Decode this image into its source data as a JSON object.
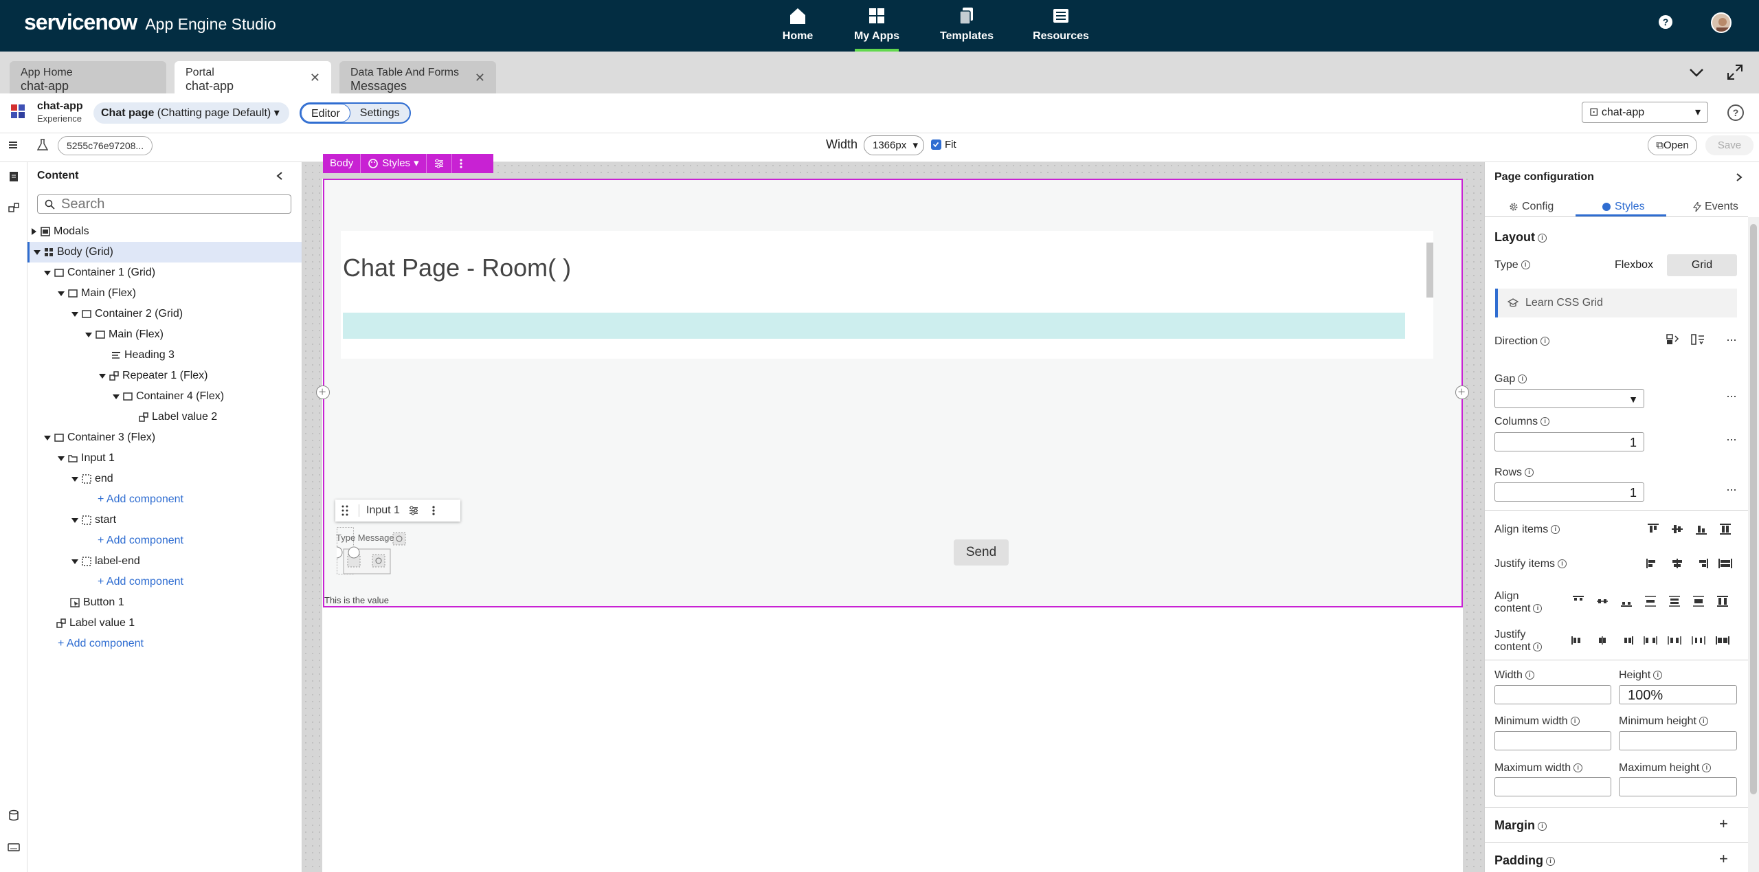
{
  "brand": {
    "logo": "servicenow",
    "product": "App Engine Studio"
  },
  "nav": [
    {
      "label": "Home",
      "icon": "home-icon"
    },
    {
      "label": "My Apps",
      "icon": "grid-icon",
      "active": true
    },
    {
      "label": "Templates",
      "icon": "templates-icon"
    },
    {
      "label": "Resources",
      "icon": "book-icon"
    }
  ],
  "tabs": [
    {
      "line1": "App Home",
      "line2": "chat-app"
    },
    {
      "line1": "Portal",
      "line2": "chat-app",
      "active": true
    },
    {
      "line1": "Data Table And Forms",
      "line2": "Messages"
    }
  ],
  "experience": {
    "name": "chat-app",
    "type": "Experience",
    "page_bold": "Chat page",
    "page_variant": "(Chatting page Default)",
    "mode_editor": "Editor",
    "mode_settings": "Settings",
    "app_select": "chat-app"
  },
  "toolbar": {
    "sys_id": "5255c76e97208...",
    "width_label": "Width",
    "width_value": "1366px",
    "fit_label": "Fit",
    "open_label": "Open",
    "save_label": "Save"
  },
  "content_panel": {
    "title": "Content",
    "search_placeholder": "Search",
    "tree": [
      {
        "label": "Modals"
      },
      {
        "label": "Body (Grid)"
      },
      {
        "label": "Container 1 (Grid)"
      },
      {
        "label": "Main (Flex)"
      },
      {
        "label": "Container 2 (Grid)"
      },
      {
        "label": "Main (Flex)"
      },
      {
        "label": "Heading 3"
      },
      {
        "label": "Repeater 1 (Flex)"
      },
      {
        "label": "Container 4 (Flex)"
      },
      {
        "label": "Label value 2"
      },
      {
        "label": "Container 3 (Flex)"
      },
      {
        "label": "Input 1"
      },
      {
        "label": "end"
      },
      {
        "label": "+ Add component"
      },
      {
        "label": "start"
      },
      {
        "label": "+ Add component"
      },
      {
        "label": "label-end"
      },
      {
        "label": "+ Add component"
      },
      {
        "label": "Button 1"
      },
      {
        "label": "Label value 1"
      },
      {
        "label": "+ Add component"
      }
    ]
  },
  "canvas": {
    "body_label": "Body",
    "styles_label": "Styles",
    "chat_title": "Chat Page - Room( )",
    "input_label": "Input 1",
    "type_message": "Type Message",
    "send_label": "Send",
    "value_text": "This is the value"
  },
  "right_panel": {
    "title": "Page configuration",
    "tabs": [
      "Config",
      "Styles",
      "Events"
    ],
    "layout_heading": "Layout",
    "type_label": "Type",
    "type_flexbox": "Flexbox",
    "type_grid": "Grid",
    "learn_link": "Learn CSS Grid",
    "direction_label": "Direction",
    "gap_label": "Gap",
    "columns_label": "Columns",
    "columns_value": "1",
    "rows_label": "Rows",
    "rows_value": "1",
    "align_items_label": "Align items",
    "justify_items_label": "Justify items",
    "align_content_label1": "Align",
    "align_content_label2": "content",
    "justify_content_label1": "Justify",
    "justify_content_label2": "content",
    "width_label": "Width",
    "height_label": "Height",
    "height_value": "100%",
    "min_width_label": "Minimum width",
    "min_height_label": "Minimum height",
    "max_width_label": "Maximum width",
    "max_height_label": "Maximum height",
    "margin_heading": "Margin",
    "padding_heading": "Padding"
  },
  "colors": {
    "nav_bg": "#032d42",
    "accent": "#2f6dd1",
    "selection": "#c822d3",
    "active_nav": "#62d84e"
  }
}
